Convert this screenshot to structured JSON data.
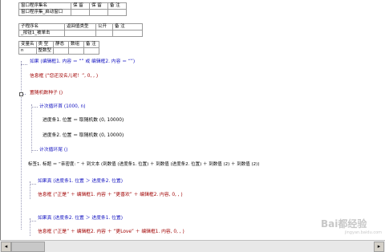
{
  "program_set": {
    "headers": [
      "窗口程序集名",
      "保 留",
      "保 留",
      "备 注"
    ],
    "values": [
      "窗口程序集_启动窗口",
      "",
      "",
      ""
    ]
  },
  "subprogram": {
    "headers": [
      "子程序名",
      "返回值类型",
      "公开",
      "备 注"
    ],
    "values": [
      "_按钮1_被单击",
      "",
      "",
      ""
    ]
  },
  "variables": {
    "headers": [
      "变量名",
      "类 型",
      "静态",
      "数组",
      "备 注"
    ],
    "values": [
      "n",
      "整数型",
      "",
      "",
      ""
    ]
  },
  "code": {
    "if1": "如果  (编辑框1. 内容 ＝ “”  或  编辑框2. 内容 ＝ “”)",
    "msg1": "信息框 (“您还没名儿呢！”, 0, , )",
    "random": "置随机数种子 ()",
    "loop_start": "计次循环首 (1000, n)",
    "prog1": "进度条1. 位置 ＝ 取随机数 (0, 10000)",
    "prog2": "进度条2. 位置 ＝ 取随机数 (0, 10000)",
    "loop_end": "计次循环尾 ()",
    "label": "标签1. 标题 ＝ “亲密度: ” ＋ 到文本 (到数值 (进度条1. 位置) ＋ 到数值 (进度条2. 位置) ＋ 到数值 (2) ＋ 到数值 (2))",
    "if2": "如果真 (进度条1. 位置 ＞ 进度条2. 位置)",
    "msg2": "信息框 (“正是” ＋ 编辑框1. 内容 ＋ “更喜欢” ＋ 编辑框2. 内容, 0, , )",
    "if3": "如果真 (进度条2. 位置 ＞ 进度条1. 位置)",
    "msg3": "信息框 (“正是” ＋ 编辑框2. 内容 ＋ “更Love” ＋ 编辑框1. 内容, 0, , )"
  },
  "watermark": {
    "text": "Bai都经验",
    "sub": "jingyan.baidu.com"
  }
}
